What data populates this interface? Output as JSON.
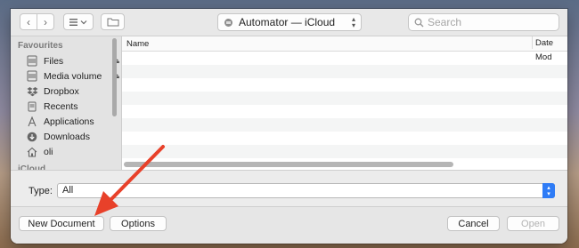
{
  "toolbar": {
    "location_label": "Automator — iCloud",
    "search_placeholder": "Search"
  },
  "sidebar": {
    "section_favourites": "Favourites",
    "section_icloud": "iCloud",
    "items": [
      {
        "label": "Files",
        "icon": "drive-icon",
        "eject": true
      },
      {
        "label": "Media volume",
        "icon": "drive-icon",
        "eject": true
      },
      {
        "label": "Dropbox",
        "icon": "dropbox-icon",
        "eject": false
      },
      {
        "label": "Recents",
        "icon": "recents-icon",
        "eject": false
      },
      {
        "label": "Applications",
        "icon": "applications-icon",
        "eject": false
      },
      {
        "label": "Downloads",
        "icon": "downloads-icon",
        "eject": false
      },
      {
        "label": "oli",
        "icon": "home-icon",
        "eject": false
      }
    ]
  },
  "filelist": {
    "columns": [
      "Name",
      "Date Mod"
    ]
  },
  "typebar": {
    "label": "Type:",
    "selected": "All"
  },
  "buttons": {
    "new_document": "New Document",
    "options": "Options",
    "cancel": "Cancel",
    "open": "Open"
  },
  "colors": {
    "accent": "#2f7cf6",
    "annotation_arrow": "#e8412a"
  }
}
